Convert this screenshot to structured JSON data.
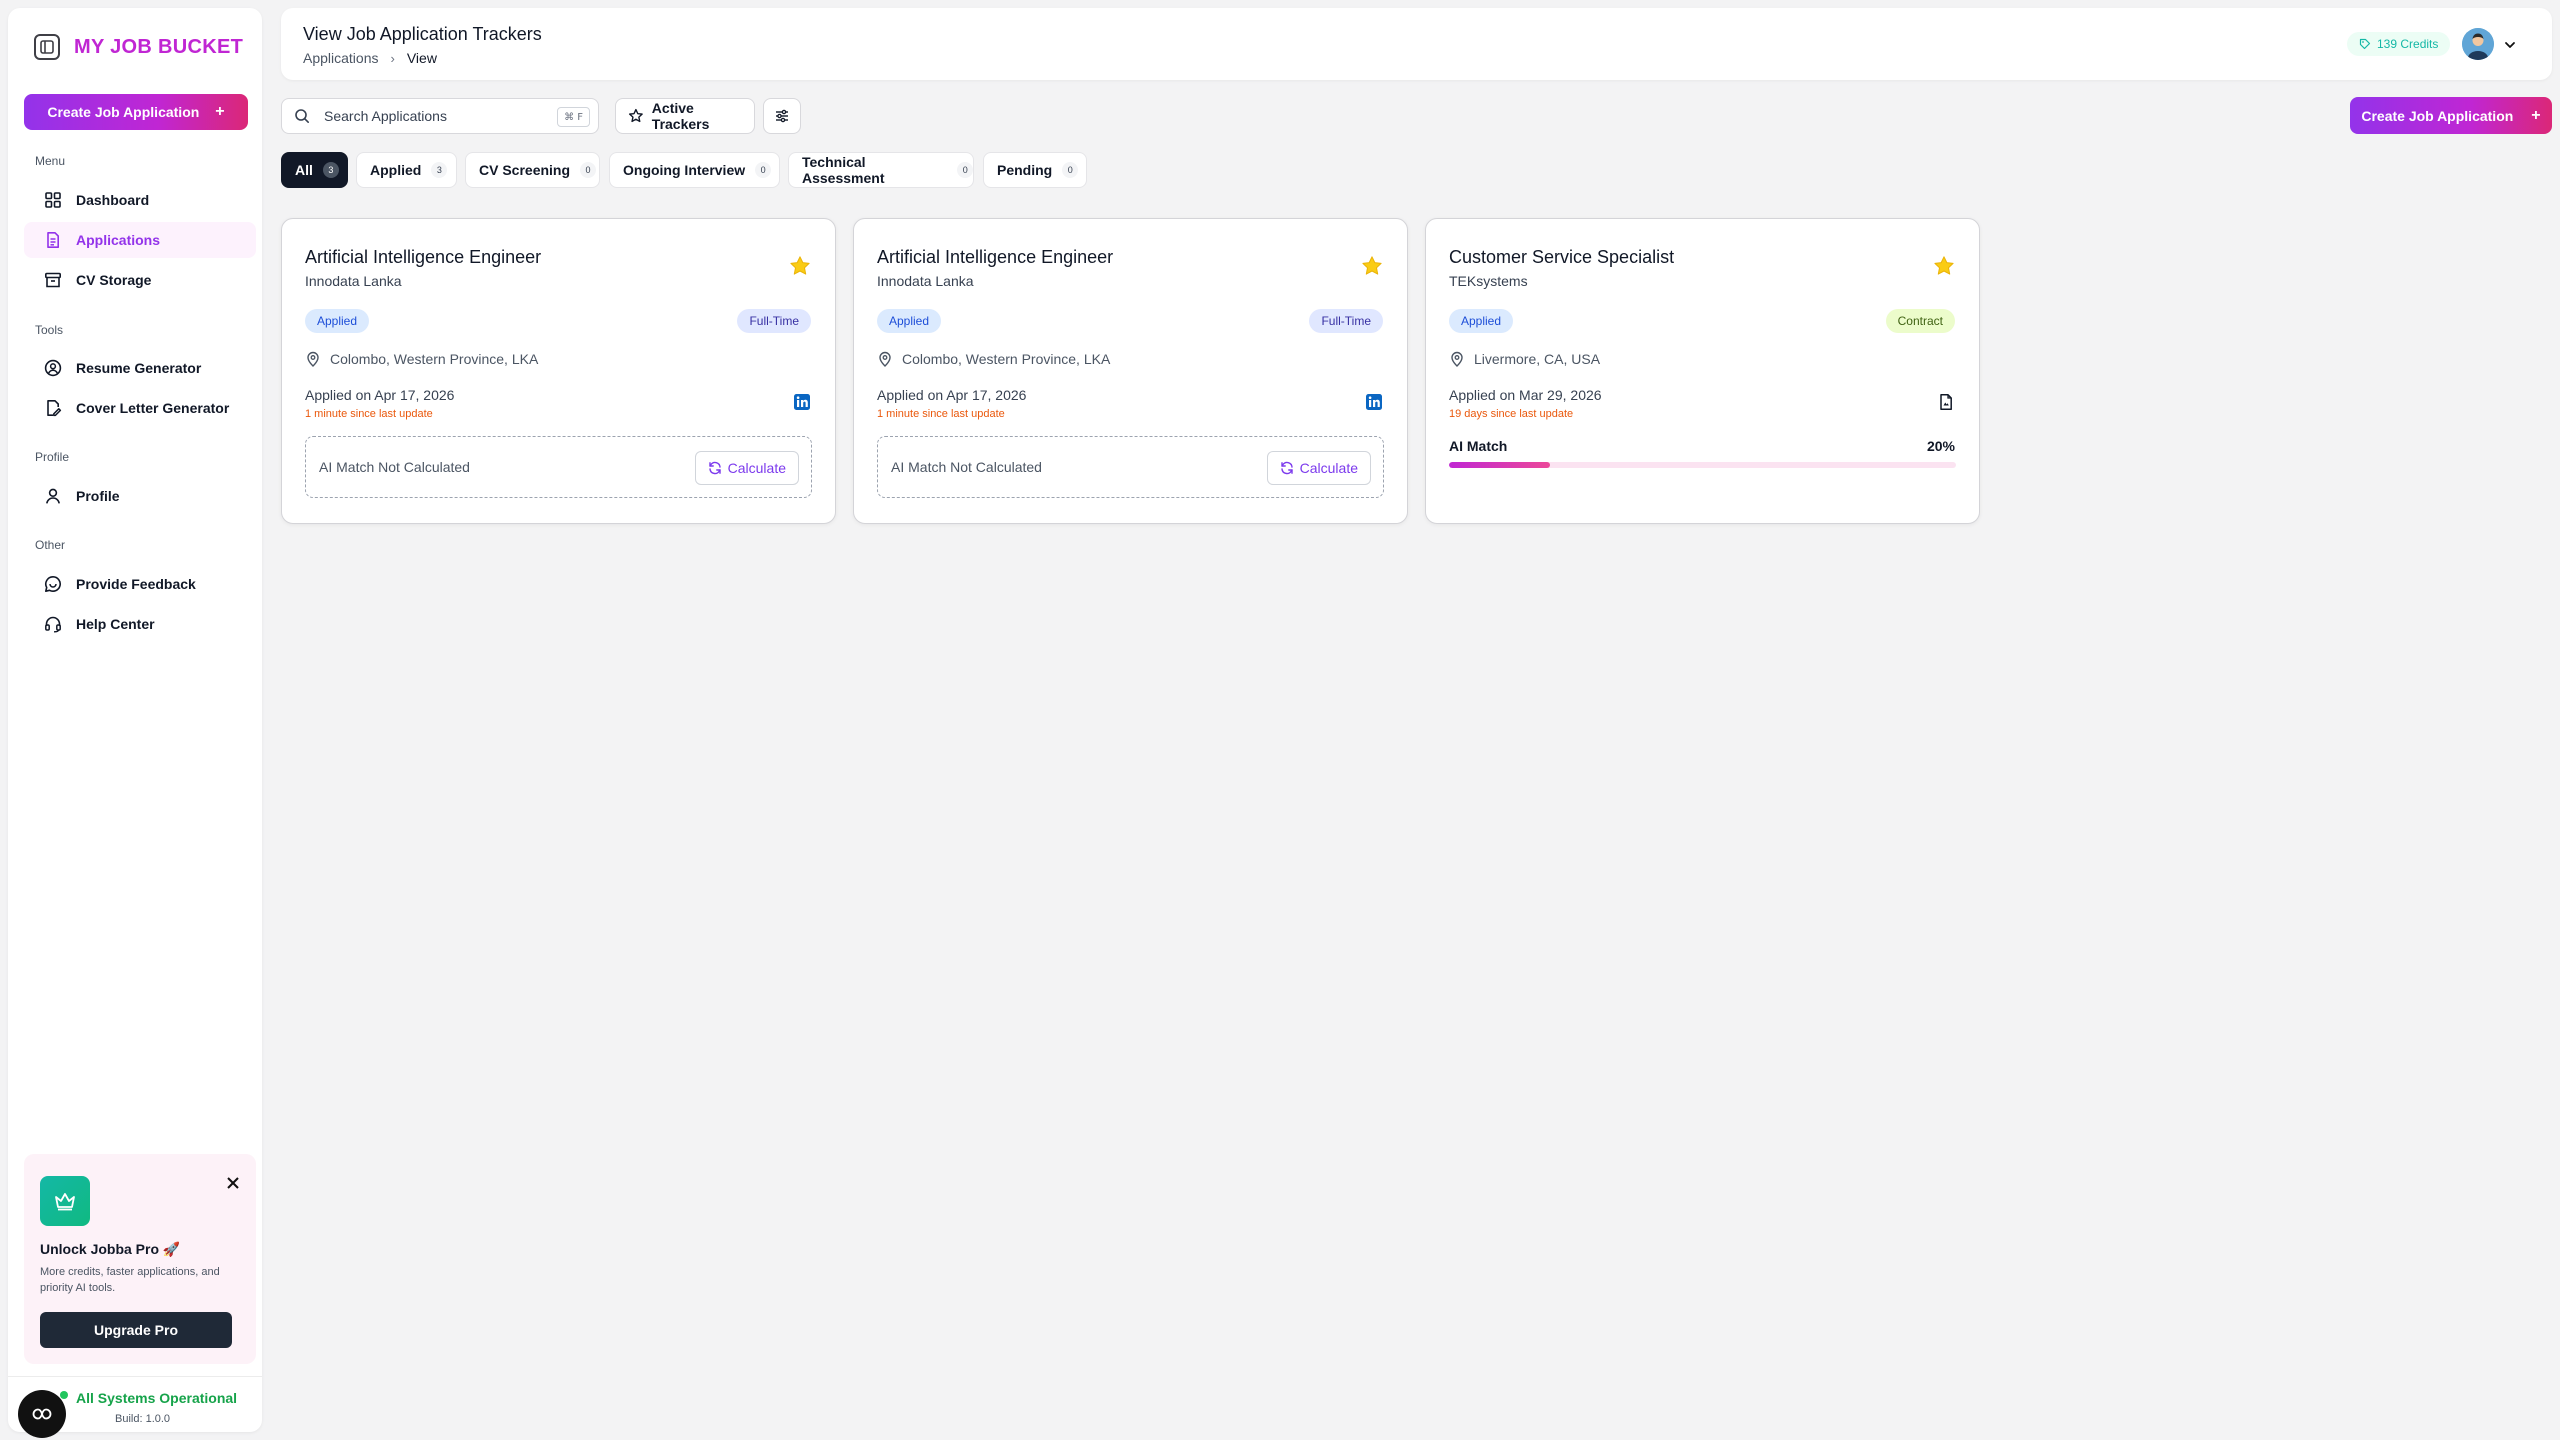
{
  "sidebar": {
    "logo_text": "MY JOB BUCKET",
    "create_label": "Create Job Application",
    "sections": {
      "menu": "Menu",
      "tools": "Tools",
      "profile": "Profile",
      "other": "Other"
    },
    "items": [
      {
        "label": "Dashboard",
        "icon": "grid-icon"
      },
      {
        "label": "Applications",
        "icon": "document-icon",
        "active": true
      },
      {
        "label": "CV Storage",
        "icon": "archive-icon"
      },
      {
        "label": "Resume Generator",
        "icon": "user-circle-icon"
      },
      {
        "label": "Cover Letter Generator",
        "icon": "file-pen-icon"
      },
      {
        "label": "Profile",
        "icon": "user-icon"
      },
      {
        "label": "Provide Feedback",
        "icon": "message-icon"
      },
      {
        "label": "Help Center",
        "icon": "headset-icon"
      }
    ],
    "promo": {
      "title": "Unlock Jobba Pro 🚀",
      "description": "More credits, faster applications, and priority AI tools.",
      "button": "Upgrade Pro"
    },
    "status": {
      "text": "All Systems Operational",
      "build": "Build: 1.0.0"
    }
  },
  "header": {
    "title": "View Job Application Trackers",
    "breadcrumb": [
      "Applications",
      "View"
    ],
    "credits": "139 Credits"
  },
  "toolbar": {
    "search_placeholder": "Search Applications",
    "search_shortcut": "⌘ F",
    "active_trackers_label": "Active Trackers",
    "create_label": "Create Job Application"
  },
  "tabs": [
    {
      "label": "All",
      "count": "3",
      "active": true
    },
    {
      "label": "Applied",
      "count": "3"
    },
    {
      "label": "CV Screening",
      "count": "0"
    },
    {
      "label": "Ongoing Interview",
      "count": "0"
    },
    {
      "label": "Technical Assessment",
      "count": "0"
    },
    {
      "label": "Pending",
      "count": "0"
    }
  ],
  "cards": [
    {
      "title": "Artificial Intelligence Engineer",
      "company": "Innodata Lanka",
      "status": "Applied",
      "type": "Full-Time",
      "location": "Colombo, Western Province, LKA",
      "applied": "Applied on Apr 17, 2026",
      "since": "1 minute since last update",
      "source_icon": "linkedin-icon",
      "ai_text": "AI Match Not Calculated",
      "calc_label": "Calculate"
    },
    {
      "title": "Artificial Intelligence Engineer",
      "company": "Innodata Lanka",
      "status": "Applied",
      "type": "Full-Time",
      "location": "Colombo, Western Province, LKA",
      "applied": "Applied on Apr 17, 2026",
      "since": "1 minute since last update",
      "source_icon": "linkedin-icon",
      "ai_text": "AI Match Not Calculated",
      "calc_label": "Calculate"
    },
    {
      "title": "Customer Service Specialist",
      "company": "TEKsystems",
      "status": "Applied",
      "type": "Contract",
      "location": "Livermore, CA, USA",
      "applied": "Applied on Mar 29, 2026",
      "since": "19 days since last update",
      "source_icon": "file-icon",
      "match_label": "AI Match",
      "match_pct": "20%",
      "match_value": 0.2
    }
  ],
  "colors": {
    "accent": "#c026d3",
    "brand_gradient_start": "#9333ea",
    "brand_gradient_end": "#db2777",
    "status_ok": "#16a34a",
    "warning": "#ea580c",
    "star": "#facc15"
  }
}
